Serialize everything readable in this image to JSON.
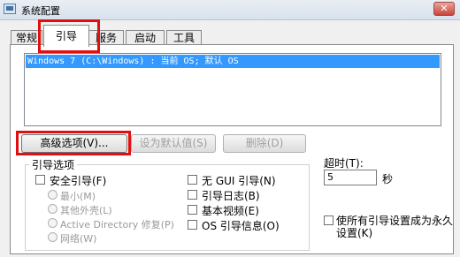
{
  "window": {
    "title": "系统配置",
    "close": "✕"
  },
  "tabs": [
    {
      "label": "常规"
    },
    {
      "label": "引导"
    },
    {
      "label": "服务"
    },
    {
      "label": "启动"
    },
    {
      "label": "工具"
    }
  ],
  "boot_list": {
    "items": [
      "Windows 7 (C:\\Windows) : 当前 OS; 默认 OS"
    ]
  },
  "buttons": {
    "advanced": "高级选项(V)...",
    "set_default": "设为默认值(S)",
    "delete": "删除(D)"
  },
  "boot_options": {
    "title": "引导选项",
    "safe_boot": "安全引导(F)",
    "minimal": "最小(M)",
    "alternate_shell": "其他外壳(L)",
    "ad_repair": "Active Directory 修复(P)",
    "network": "网络(W)",
    "no_gui": "无 GUI 引导(N)",
    "boot_log": "引导日志(B)",
    "base_video": "基本视频(E)",
    "os_boot_info": "OS 引导信息(O)"
  },
  "timeout": {
    "label": "超时(T):",
    "value": "5",
    "unit": "秒"
  },
  "permanent": {
    "line1": "使所有引导设置成为永久",
    "line2": "设置(K)"
  }
}
